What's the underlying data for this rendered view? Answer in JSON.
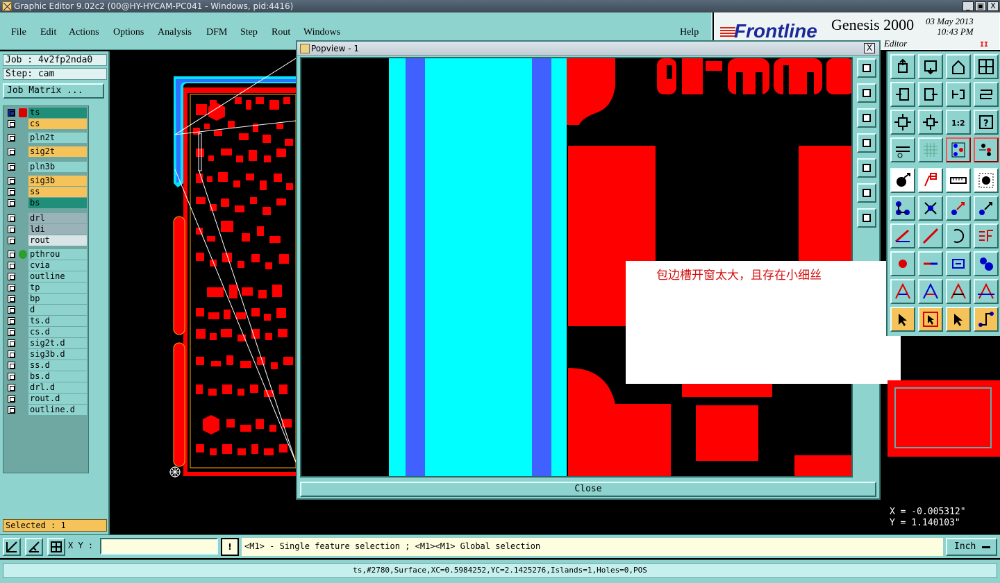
{
  "window": {
    "title": "Graphic Editor 9.02c2 (00@HY-HYCAM-PC041 - Windows, pid:4416)",
    "controls": [
      "_",
      "▣",
      "X"
    ]
  },
  "menu": [
    "File",
    "Edit",
    "Actions",
    "Options",
    "Analysis",
    "DFM",
    "Step",
    "Rout",
    "Windows",
    "Help"
  ],
  "brand": {
    "logo": "Frontline",
    "product": "Genesis 2000",
    "date": "03 May 2013",
    "time": "10:43 PM",
    "mode": "Editor",
    "pause_icon": "II"
  },
  "left": {
    "job": "Job : 4v2fp2nda0",
    "step": "Step: cam",
    "job_matrix": "Job Matrix ...",
    "layers": [
      {
        "name": "ts",
        "color": "#1f8f7a",
        "mark": "edit-cursor-icon"
      },
      {
        "name": "cs",
        "color": "#f6c35a"
      },
      {
        "name": "pln2t",
        "color": "#8fd3cf"
      },
      {
        "name": "sig2t",
        "color": "#f6c35a"
      },
      {
        "name": "pln3b",
        "color": "#8fd3cf"
      },
      {
        "name": "sig3b",
        "color": "#f6c35a"
      },
      {
        "name": "ss",
        "color": "#f6c35a"
      },
      {
        "name": "bs",
        "color": "#1f8f7a"
      },
      {
        "name": "drl",
        "color": "#9ab3b8"
      },
      {
        "name": "ldi",
        "color": "#9ab3b8"
      },
      {
        "name": "rout",
        "color": "#d9e4e6"
      },
      {
        "name": "pthrou",
        "color": "#8fd3cf",
        "mark": "green-dot-icon"
      },
      {
        "name": "cvia",
        "color": "#8fd3cf"
      },
      {
        "name": "outline",
        "color": "#8fd3cf"
      },
      {
        "name": "tp",
        "color": "#8fd3cf"
      },
      {
        "name": "bp",
        "color": "#8fd3cf"
      },
      {
        "name": "d",
        "color": "#8fd3cf"
      },
      {
        "name": "ts.d",
        "color": "#8fd3cf"
      },
      {
        "name": "cs.d",
        "color": "#8fd3cf"
      },
      {
        "name": "sig2t.d",
        "color": "#8fd3cf"
      },
      {
        "name": "sig3b.d",
        "color": "#8fd3cf"
      },
      {
        "name": "ss.d",
        "color": "#8fd3cf"
      },
      {
        "name": "bs.d",
        "color": "#8fd3cf"
      },
      {
        "name": "drl.d",
        "color": "#8fd3cf"
      },
      {
        "name": "rout.d",
        "color": "#8fd3cf"
      },
      {
        "name": "outline.d",
        "color": "#8fd3cf"
      }
    ],
    "selected": "Selected : 1"
  },
  "popview": {
    "title": "Popview - 1",
    "close_label": "Close",
    "close_icon": "X"
  },
  "annotation": "包边槽开窗太大，且存在小细丝",
  "coords": {
    "x": "X = -0.005312\"",
    "y": "Y = 1.140103\""
  },
  "command": {
    "xy_label": "X Y :",
    "xy_value": "",
    "help_icon": "!",
    "hint": "<M1> - Single feature selection ; <M1><M1> Global selection",
    "unit": "Inch"
  },
  "status": "ts,#2780,Surface,XC=0.5984252,YC=2.1425276,Islands=1,Holes=0,POS",
  "colors": {
    "panel": "#8fd3cf",
    "copper": "#ff0000",
    "outline": "#00ffff",
    "slot_edge": "#4060ff",
    "highlight": "#f6c35a"
  }
}
